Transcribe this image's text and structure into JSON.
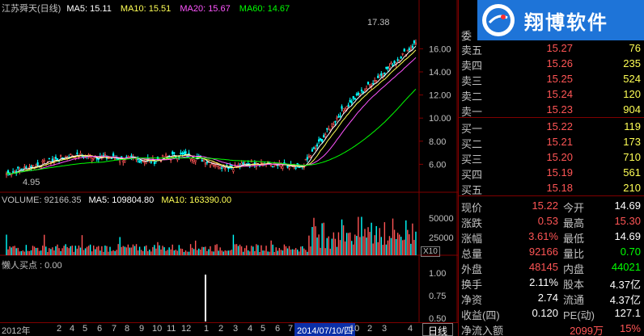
{
  "main_chart": {
    "stock_name": "江苏舜天(日线)",
    "ma5": "MA5: 15.11",
    "ma10": "MA10: 15.51",
    "ma20": "MA20: 15.67",
    "ma60": "MA60: 14.67",
    "high_marker": "17.38",
    "low_marker": "4.95",
    "y_ticks": [
      "16.00",
      "14.00",
      "12.00",
      "10.00",
      "8.00",
      "6.00"
    ]
  },
  "volume_chart": {
    "volume": "VOLUME: 92166.35",
    "ma5": "MA5: 109804.80",
    "ma10": "MA10: 163390.00",
    "y_ticks": [
      "50000",
      "25000"
    ],
    "scale": "X10"
  },
  "indicator_chart": {
    "title": "懒人买点 : 0.00",
    "y_ticks": [
      "1.00",
      "0.75",
      "0.50"
    ]
  },
  "bottom_bar": {
    "ticks": [
      "2012年",
      "2",
      "4",
      "5",
      "6",
      "7",
      "8",
      "9",
      "10",
      "11",
      "12",
      "1",
      "2",
      "3",
      "4",
      "5",
      "6",
      "7",
      "10",
      "2",
      "3",
      "4"
    ],
    "date_highlight": "2014/07/10/四",
    "period_button": "日线"
  },
  "logo": {
    "text": "翔博软件"
  },
  "order_book": {
    "header": "委",
    "sells": [
      {
        "name": "卖五",
        "price": "15.27",
        "vol": "76"
      },
      {
        "name": "卖四",
        "price": "15.26",
        "vol": "235"
      },
      {
        "name": "卖三",
        "price": "15.25",
        "vol": "524"
      },
      {
        "name": "卖二",
        "price": "15.24",
        "vol": "120"
      },
      {
        "name": "卖一",
        "price": "15.23",
        "vol": "904"
      }
    ],
    "buys": [
      {
        "name": "买一",
        "price": "15.22",
        "vol": "119"
      },
      {
        "name": "买二",
        "price": "15.21",
        "vol": "173"
      },
      {
        "name": "买三",
        "price": "15.20",
        "vol": "710"
      },
      {
        "name": "买四",
        "price": "15.19",
        "vol": "561"
      },
      {
        "name": "买五",
        "price": "15.18",
        "vol": "210"
      }
    ]
  },
  "quote": {
    "rows": [
      {
        "l1": "现价",
        "v1": "15.22",
        "l2": "今开",
        "v2": "14.69"
      },
      {
        "l1": "涨跌",
        "v1": "0.53",
        "l2": "最高",
        "v2": "15.30"
      },
      {
        "l1": "涨幅",
        "v1": "3.61%",
        "l2": "最低",
        "v2": "14.69"
      },
      {
        "l1": "总量",
        "v1": "92166",
        "l2": "量比",
        "v2": "0.70"
      },
      {
        "l1": "外盘",
        "v1": "48145",
        "l2": "内盘",
        "v2": "44021"
      },
      {
        "l1": "换手",
        "v1": "2.11%",
        "l2": "股本",
        "v2": "4.37亿"
      },
      {
        "l1": "净资",
        "v1": "2.74",
        "l2": "流通",
        "v2": "4.37亿"
      },
      {
        "l1": "收益(四)",
        "v1": "0.120",
        "l2": "PE(动)",
        "v2": "127.1"
      }
    ],
    "net_inflow_label": "净流入额",
    "net_inflow_value": "2099万",
    "net_inflow_pct": "15%"
  },
  "colors": {
    "up": "#ff5555",
    "down": "#00ff00",
    "ma5": "#ffffff",
    "ma10": "#ffff55",
    "ma20": "#ff55ff",
    "ma60": "#00ff00",
    "grid": "#800000"
  }
}
